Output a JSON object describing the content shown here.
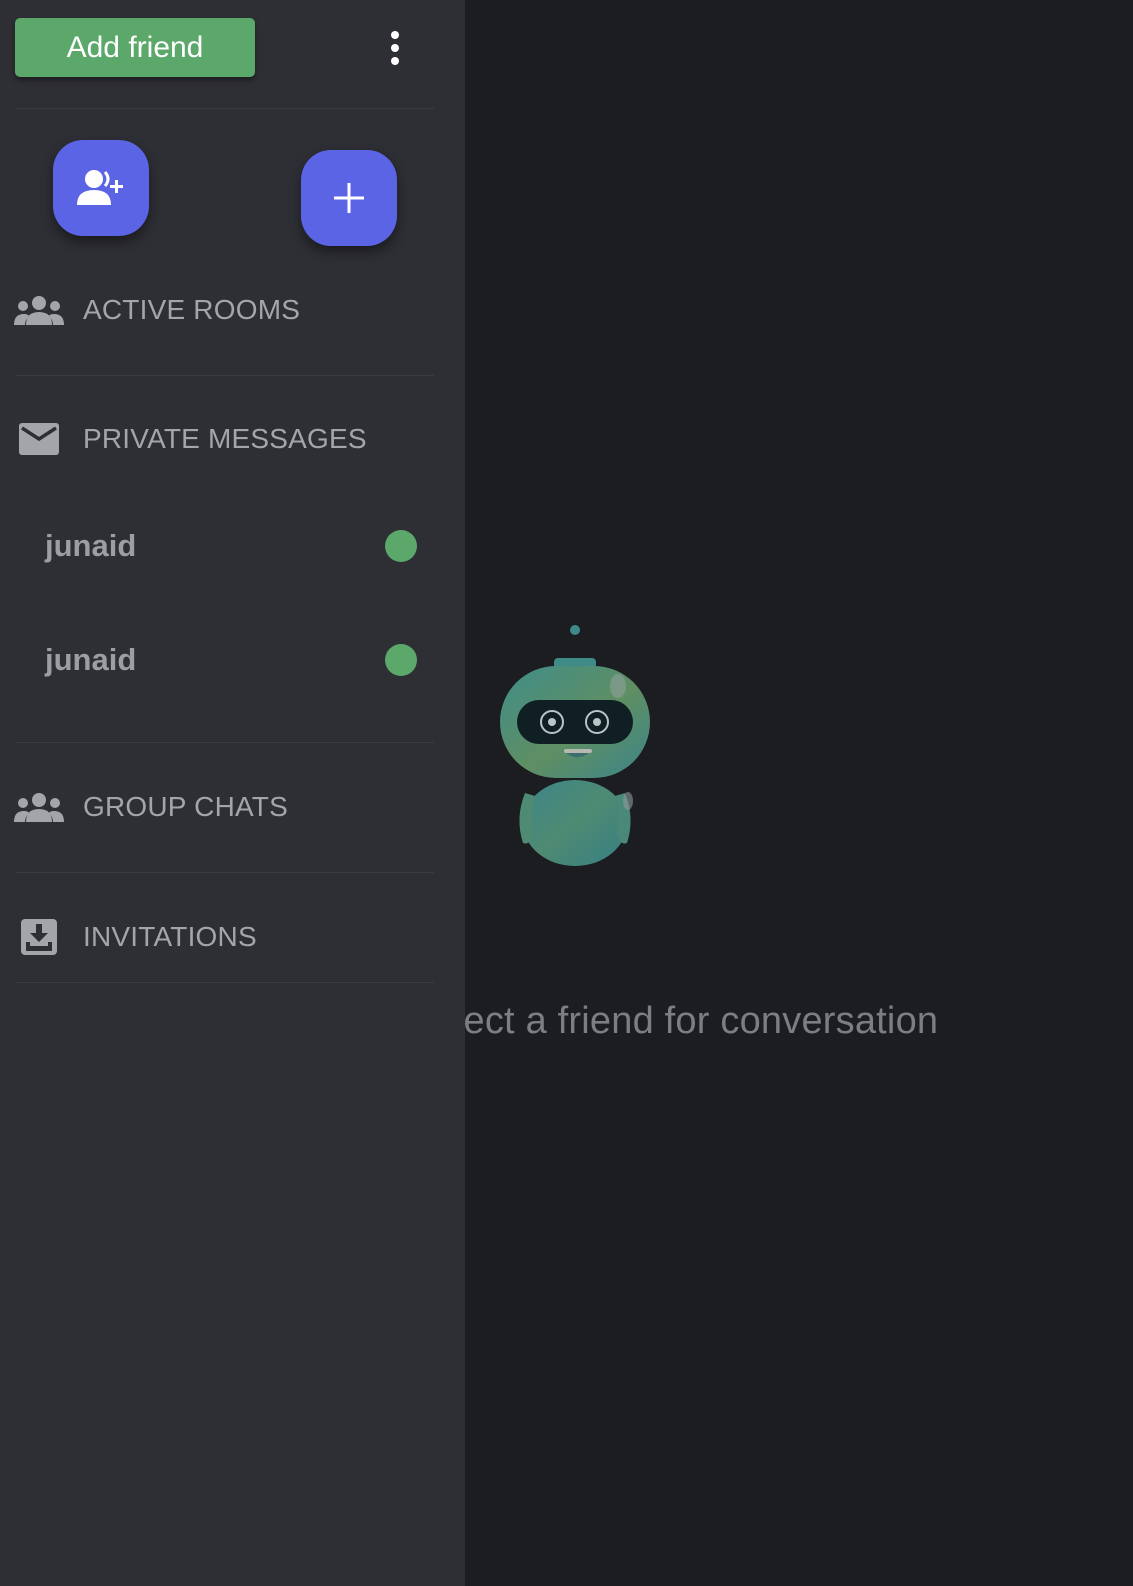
{
  "header": {
    "add_friend_label": "Add friend"
  },
  "fabs": {
    "add_user_icon": "person-add-icon",
    "add_room_icon": "plus-icon"
  },
  "sections": {
    "active_rooms": "ACTIVE ROOMS",
    "private_messages": "PRIVATE MESSAGES",
    "group_chats": "GROUP CHATS",
    "invitations": "INVITATIONS"
  },
  "contacts": [
    {
      "name": "junaid",
      "status": "online"
    },
    {
      "name": "junaid",
      "status": "online"
    }
  ],
  "main": {
    "empty_message": "Select a friend for conversation"
  },
  "colors": {
    "sidebar_bg": "#2e2f35",
    "main_bg": "#1c1d21",
    "accent": "#5c64e6",
    "add_friend_green": "#5ba86a",
    "online": "#5ba86a",
    "muted_text": "#a4a5aa"
  }
}
